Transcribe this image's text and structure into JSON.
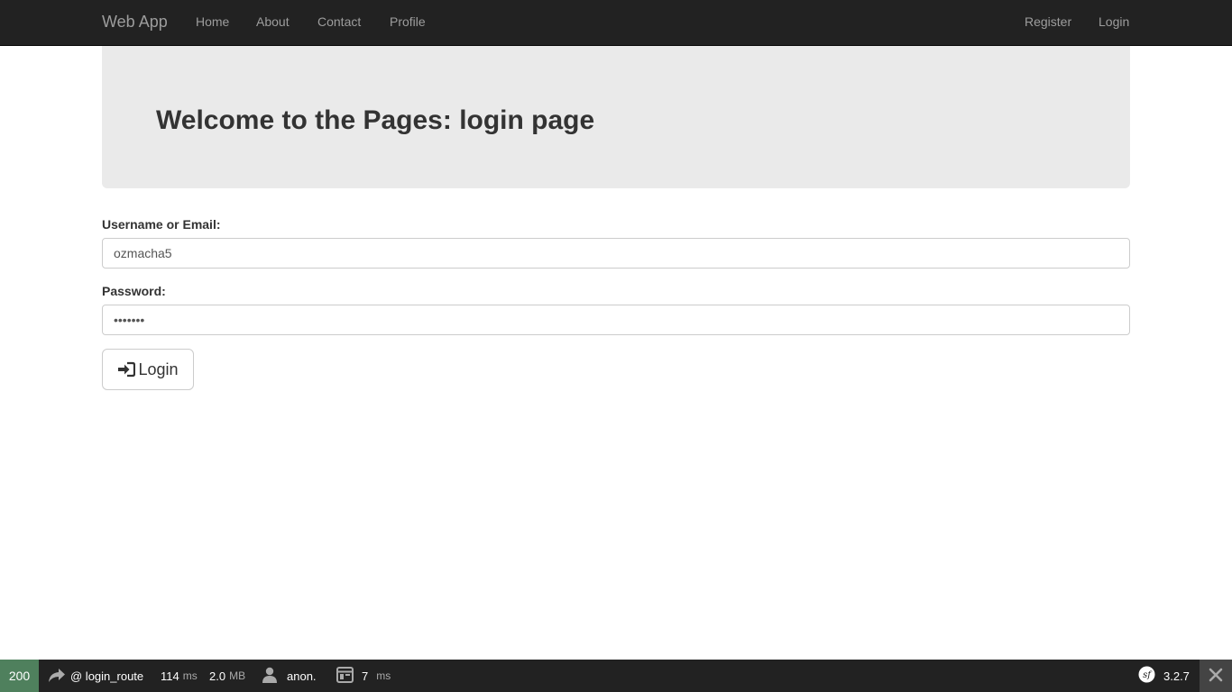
{
  "navbar": {
    "brand": "Web App",
    "links": [
      "Home",
      "About",
      "Contact",
      "Profile"
    ],
    "right_links": [
      "Register",
      "Login"
    ]
  },
  "jumbotron": {
    "title": "Welcome to the Pages: login page"
  },
  "form": {
    "username_label": "Username or Email:",
    "username_value": "ozmacha5",
    "password_label": "Password:",
    "password_value": "•••••••",
    "submit_label": "Login"
  },
  "toolbar": {
    "status_code": "200",
    "route": "@ login_route",
    "time_value": "114",
    "time_unit": "ms",
    "memory_value": "2.0",
    "memory_unit": "MB",
    "user": "anon.",
    "template_time_value": "7",
    "template_time_unit": "ms",
    "version": "3.2.7",
    "status_color": "#4f805d"
  },
  "icons": {
    "login": "sign-in-icon",
    "route": "redirect-arrow-icon",
    "user": "user-icon",
    "template": "layout-icon",
    "symfony": "symfony-logo-icon",
    "close": "close-icon"
  }
}
